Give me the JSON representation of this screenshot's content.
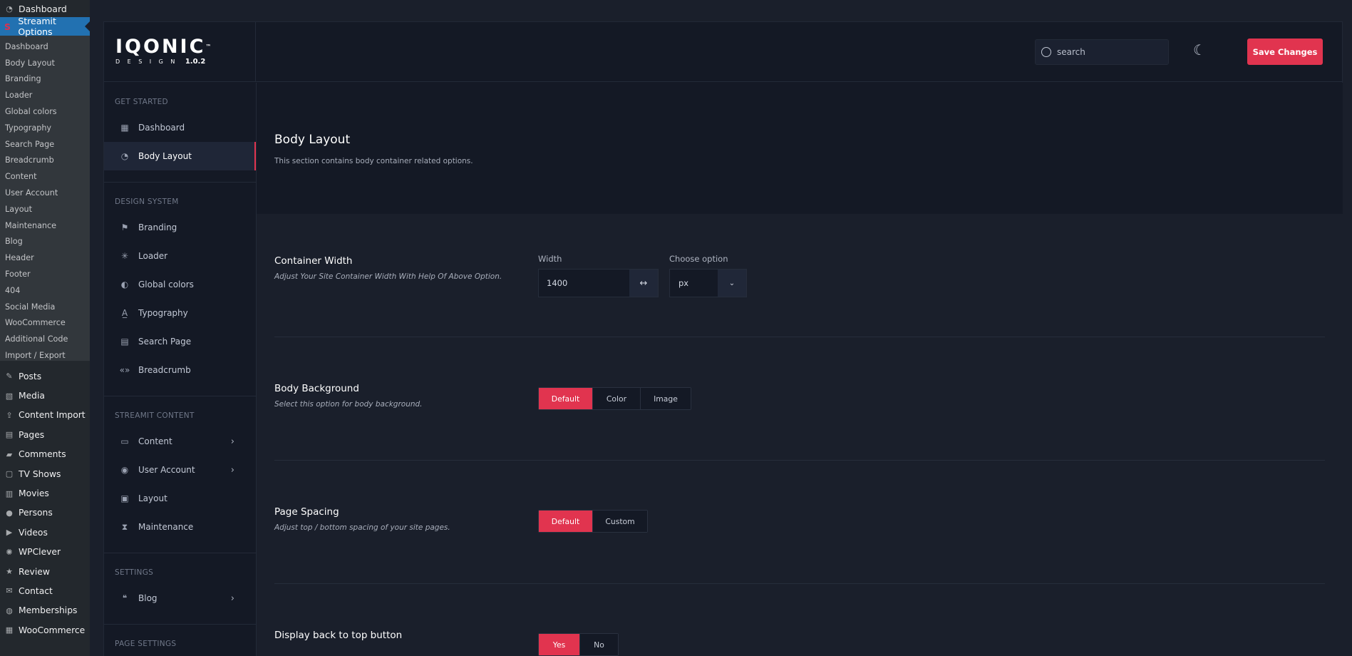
{
  "wp_admin": {
    "top": {
      "label": "Dashboard",
      "icon": "gauge-icon"
    },
    "active": {
      "label": "Streamit Options",
      "icon": "streamit-s-icon"
    },
    "submenu": [
      "Dashboard",
      "Body Layout",
      "Branding",
      "Loader",
      "Global colors",
      "Typography",
      "Search Page",
      "Breadcrumb",
      "Content",
      "User Account",
      "Layout",
      "Maintenance",
      "Blog",
      "Header",
      "Footer",
      "404",
      "Social Media",
      "WooCommerce",
      "Additional Code",
      "Import / Export"
    ],
    "menu": [
      {
        "label": "Posts",
        "icon": "pin-icon"
      },
      {
        "label": "Media",
        "icon": "media-icon"
      },
      {
        "label": "Content Import",
        "icon": "import-icon"
      },
      {
        "label": "Pages",
        "icon": "pages-icon"
      },
      {
        "label": "Comments",
        "icon": "comments-icon"
      },
      {
        "label": "TV Shows",
        "icon": "tv-icon"
      },
      {
        "label": "Movies",
        "icon": "film-icon"
      },
      {
        "label": "Persons",
        "icon": "person-icon"
      },
      {
        "label": "Videos",
        "icon": "video-icon"
      },
      {
        "label": "WPClever",
        "icon": "bulb-icon"
      },
      {
        "label": "Review",
        "icon": "star-icon"
      },
      {
        "label": "Contact",
        "icon": "mail-icon"
      },
      {
        "label": "Memberships",
        "icon": "members-icon"
      },
      {
        "label": "WooCommerce",
        "icon": "woo-icon"
      }
    ]
  },
  "header": {
    "logo_word": "IQONIC",
    "logo_tm": "™",
    "logo_design": "DESIGN",
    "version": "1.0.2",
    "search_placeholder": "search",
    "theme_toggle_icon": "moon-icon",
    "save_label": "Save Changes"
  },
  "nav": {
    "groups": [
      {
        "heading": "GET STARTED",
        "items": [
          {
            "label": "Dashboard",
            "icon": "grid-icon",
            "glyph": "▦"
          },
          {
            "label": "Body Layout",
            "icon": "gauge-icon",
            "glyph": "◔",
            "active": true
          }
        ]
      },
      {
        "heading": "DESIGN SYSTEM",
        "items": [
          {
            "label": "Branding",
            "icon": "flag-icon",
            "glyph": "⚑"
          },
          {
            "label": "Loader",
            "icon": "spinner-icon",
            "glyph": "✳"
          },
          {
            "label": "Global colors",
            "icon": "drop-icon",
            "glyph": "◐"
          },
          {
            "label": "Typography",
            "icon": "text-icon",
            "glyph": "A̲"
          },
          {
            "label": "Search Page",
            "icon": "document-icon",
            "glyph": "▤"
          },
          {
            "label": "Breadcrumb",
            "icon": "breadcrumb-icon",
            "glyph": "«»"
          }
        ]
      },
      {
        "heading": "STREAMIT CONTENT",
        "items": [
          {
            "label": "Content",
            "icon": "window-icon",
            "glyph": "▭",
            "chevron": true
          },
          {
            "label": "User Account",
            "icon": "user-circle-icon",
            "glyph": "◉",
            "chevron": true
          },
          {
            "label": "Layout",
            "icon": "layout-icon",
            "glyph": "▣"
          },
          {
            "label": "Maintenance",
            "icon": "hourglass-icon",
            "glyph": "⧗"
          }
        ]
      },
      {
        "heading": "SETTINGS",
        "items": [
          {
            "label": "Blog",
            "icon": "quote-icon",
            "glyph": "❝",
            "chevron": true
          }
        ]
      },
      {
        "heading": "PAGE SETTINGS",
        "items": []
      }
    ]
  },
  "page": {
    "title": "Body Layout",
    "description": "This section contains body container related options."
  },
  "options": {
    "container_width": {
      "title": "Container Width",
      "description": "Adjust Your Site Container Width With Help Of Above Option.",
      "width_label": "Width",
      "width_value": "1400",
      "unit_label": "Choose option",
      "unit_value": "px"
    },
    "body_background": {
      "title": "Body Background",
      "description": "Select this option for body background.",
      "choices": [
        "Default",
        "Color",
        "Image"
      ],
      "selected": "Default"
    },
    "page_spacing": {
      "title": "Page Spacing",
      "description": "Adjust top / bottom spacing of your site pages.",
      "choices": [
        "Default",
        "Custom"
      ],
      "selected": "Default"
    },
    "back_to_top": {
      "title": "Display back to top button",
      "choices": [
        "Yes",
        "No"
      ],
      "selected": "Yes"
    }
  },
  "colors": {
    "accent": "#e1344f",
    "wp_active": "#2271b1"
  }
}
